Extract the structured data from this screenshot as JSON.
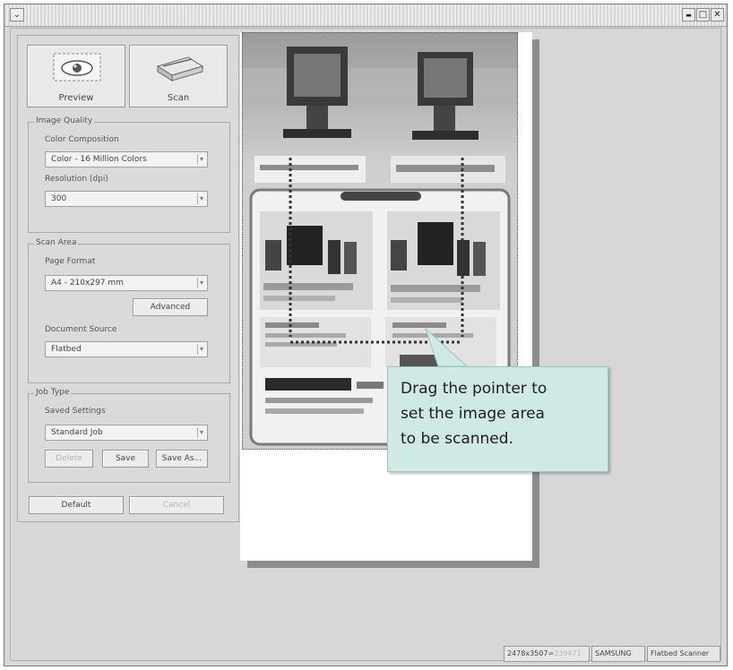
{
  "window": {
    "controls": {
      "minimize": "▬",
      "maximize": "□",
      "close": "✕"
    },
    "menu_glyph": "⌄"
  },
  "toolbar": {
    "preview_label": "Preview",
    "scan_label": "Scan"
  },
  "image_quality": {
    "title": "Image Quality",
    "color_composition_label": "Color Composition",
    "color_composition_value": "Color - 16 Million Colors",
    "resolution_label": "Resolution (dpi)",
    "resolution_value": "300"
  },
  "scan_area": {
    "title": "Scan Area",
    "page_format_label": "Page Format",
    "page_format_value": "A4 - 210x297 mm",
    "advanced_label": "Advanced",
    "document_source_label": "Document Source",
    "document_source_value": "Flatbed"
  },
  "job_type": {
    "title": "Job Type",
    "saved_settings_label": "Saved Settings",
    "saved_settings_value": "Standard Job",
    "delete_label": "Delete",
    "save_label": "Save",
    "save_as_label": "Save As..."
  },
  "footer_buttons": {
    "default_label": "Default",
    "cancel_label": "Cancel"
  },
  "callout": {
    "text": "Drag the pointer to\nset the image area\nto be scanned."
  },
  "status_bar": {
    "dimensions": "2478x3507=",
    "size_value": "339471",
    "vendor": "SAMSUNG",
    "device": "Flatbed Scanner"
  },
  "colors": {
    "window_bg": "#d8d8d8",
    "callout_bg": "#cfe9e4"
  }
}
